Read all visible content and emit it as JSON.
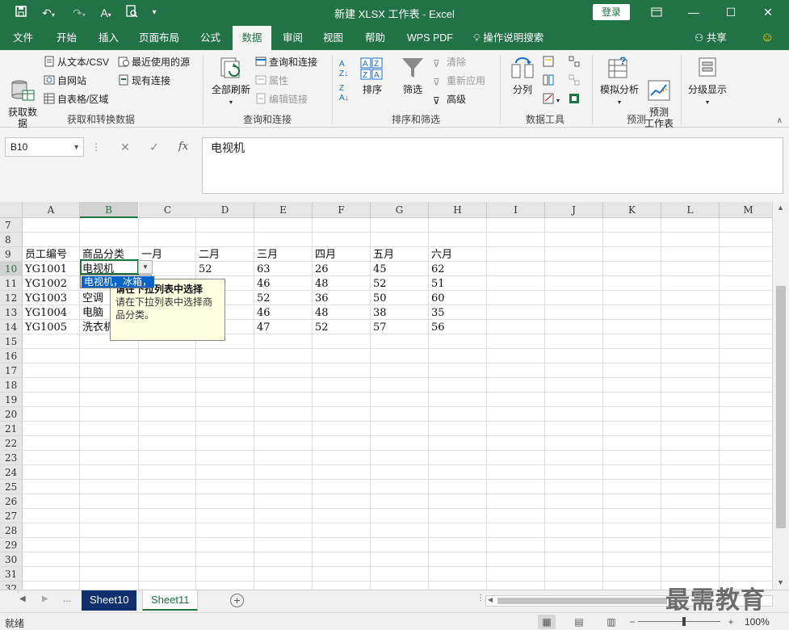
{
  "title": "新建 XLSX 工作表  -  Excel",
  "login": "登录",
  "menu": {
    "file": "文件",
    "home": "开始",
    "insert": "插入",
    "layout": "页面布局",
    "formulas": "公式",
    "data": "数据",
    "review": "审阅",
    "view": "视图",
    "help": "帮助",
    "wps": "WPS PDF",
    "tellme": "操作说明搜索",
    "share": "共享"
  },
  "ribbon": {
    "get_data": "获取数\n据",
    "from_text": "从文本/CSV",
    "from_web": "自网站",
    "from_table": "自表格/区域",
    "recent_sources": "最近使用的源",
    "existing_conn": "现有连接",
    "group1": "获取和转换数据",
    "refresh_all": "全部刷新",
    "queries_conn": "查询和连接",
    "properties": "属性",
    "edit_links": "编辑链接",
    "group2": "查询和连接",
    "sort": "排序",
    "filter": "筛选",
    "clear": "清除",
    "reapply": "重新应用",
    "advanced": "高级",
    "group3": "排序和筛选",
    "text_to_cols": "分列",
    "group4": "数据工具",
    "what_if": "模拟分析",
    "forecast_sheet": "预测\n工作表",
    "group5": "预测",
    "outline": "分级显示"
  },
  "formula_bar": {
    "name_box": "B10",
    "fx": "fx",
    "value": "电视机"
  },
  "columns": [
    "A",
    "B",
    "C",
    "D",
    "E",
    "F",
    "G",
    "H",
    "I",
    "J",
    "K",
    "L",
    "M"
  ],
  "rows": [
    "7",
    "8",
    "9",
    "10",
    "11",
    "12",
    "13",
    "14",
    "15",
    "16",
    "17",
    "18",
    "19",
    "20",
    "21",
    "22",
    "23",
    "24",
    "25",
    "26",
    "27",
    "28",
    "29",
    "30",
    "31",
    "32"
  ],
  "table": {
    "header": [
      "员工编号",
      "商品分类",
      "一月",
      "二月",
      "三月",
      "四月",
      "五月",
      "六月"
    ],
    "data": [
      [
        "YG1001",
        "电视机",
        "",
        "52",
        "63",
        "26",
        "45",
        "62"
      ],
      [
        "YG1002",
        "",
        "",
        "",
        "46",
        "48",
        "52",
        "51"
      ],
      [
        "YG1003",
        "空调",
        "",
        "",
        "52",
        "36",
        "50",
        "60"
      ],
      [
        "YG1004",
        "电脑",
        "",
        "",
        "46",
        "48",
        "38",
        "35"
      ],
      [
        "YG1005",
        "洗衣机",
        "",
        "",
        "47",
        "52",
        "57",
        "56"
      ]
    ]
  },
  "dropdown": {
    "item": "电视机，冰箱，"
  },
  "tooltip": {
    "title": "请在下拉列表中选择",
    "body": "请在下拉列表中选择商品分类。"
  },
  "sheets": {
    "tab1": "Sheet10",
    "tab2": "Sheet11",
    "more": "..."
  },
  "status": {
    "text": "就绪",
    "zoom": "100%"
  },
  "watermark": "最需教育",
  "colors": {
    "accent": "#217346",
    "sheet_active": "#0f2f6e",
    "tooltip_bg": "#ffffe1",
    "selection": "#0a63c6"
  }
}
